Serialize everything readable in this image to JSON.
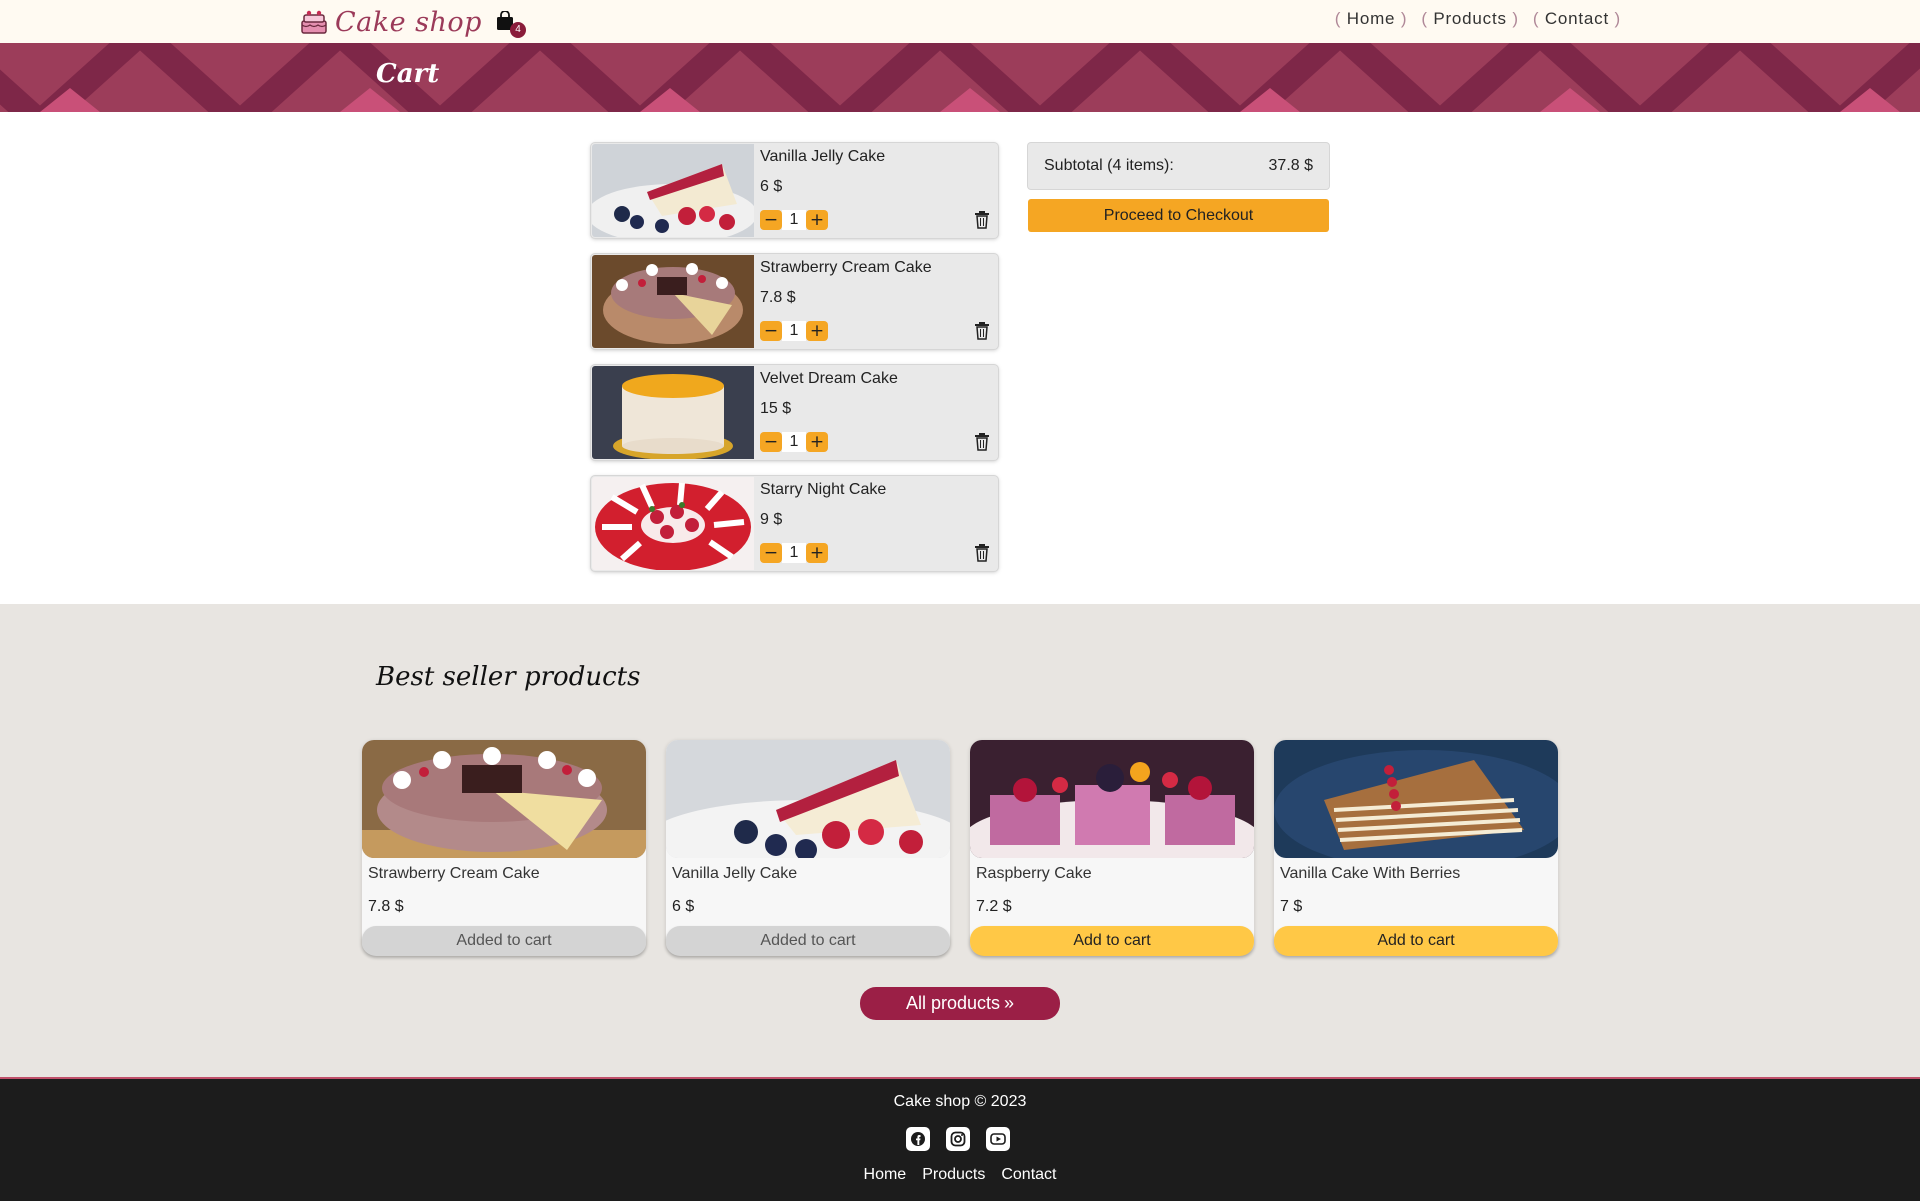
{
  "brand": {
    "name": "Cake shop",
    "cart_count": "4"
  },
  "nav": {
    "items": [
      "Home",
      "Products",
      "Contact"
    ]
  },
  "hero": {
    "title": "Cart"
  },
  "cart": {
    "items": [
      {
        "name": "Vanilla Jelly Cake",
        "price": "6 $",
        "qty": "1",
        "image": "vanilla-jelly-cake-image"
      },
      {
        "name": "Strawberry Cream Cake",
        "price": "7.8 $",
        "qty": "1",
        "image": "strawberry-cream-cake-image"
      },
      {
        "name": "Velvet Dream Cake",
        "price": "15 $",
        "qty": "1",
        "image": "velvet-dream-cake-image"
      },
      {
        "name": "Starry Night Cake",
        "price": "9 $",
        "qty": "1",
        "image": "starry-night-cake-image"
      }
    ],
    "minus_symbol": "−",
    "plus_symbol": "+"
  },
  "summary": {
    "subtotal_label": "Subtotal (4 items):",
    "subtotal_value": "37.8 $",
    "checkout_label": "Proceed to Checkout"
  },
  "best_sellers": {
    "title": "Best seller products",
    "products": [
      {
        "name": "Strawberry Cream Cake",
        "price": "7.8 $",
        "button": "Added to cart",
        "in_cart": true
      },
      {
        "name": "Vanilla Jelly Cake",
        "price": "6 $",
        "button": "Added to cart",
        "in_cart": true
      },
      {
        "name": "Raspberry Cake",
        "price": "7.2 $",
        "button": "Add to cart",
        "in_cart": false
      },
      {
        "name": "Vanilla Cake With Berries",
        "price": "7 $",
        "button": "Add to cart",
        "in_cart": false
      }
    ],
    "all_products_label": "All products",
    "all_products_icon": "»"
  },
  "footer": {
    "copyright": "Cake shop © 2023",
    "socials": [
      "facebook-icon",
      "instagram-icon",
      "youtube-icon"
    ],
    "links": [
      "Home",
      "Products",
      "Contact"
    ]
  },
  "colors": {
    "brand": "#9b3a59",
    "hero": "#9c3d5a",
    "accent_orange": "#f5a623",
    "add_to_cart": "#ffc846",
    "all_products": "#9b1f46",
    "footer_bg": "#1c1c1c"
  }
}
